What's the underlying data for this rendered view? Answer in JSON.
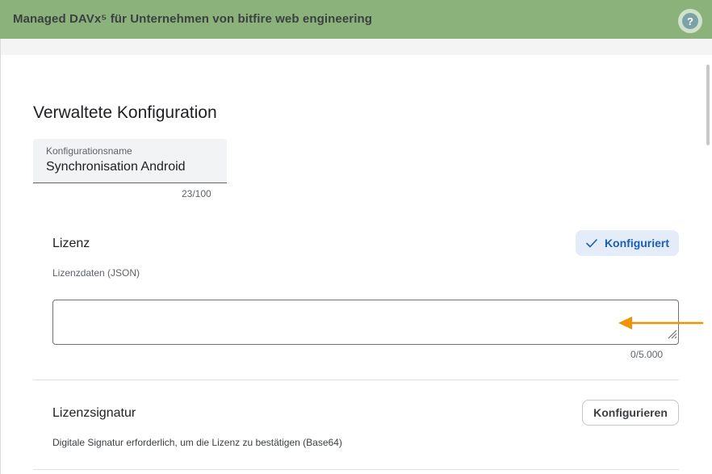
{
  "header": {
    "title": "Managed DAVx⁵ für Unternehmen von bitfire web engineering",
    "help_icon": "help-icon",
    "help_glyph": "?"
  },
  "page": {
    "title": "Verwaltete Konfiguration"
  },
  "config_name": {
    "label": "Konfigurationsname",
    "value": "Synchronisation Android",
    "counter": "23/100"
  },
  "license": {
    "title": "Lizenz",
    "subtitle": "Lizenzdaten (JSON)",
    "status_button": "Konfiguriert",
    "status_icon": "check-icon",
    "input_value": "",
    "counter": "0/5.000"
  },
  "signature": {
    "title": "Lizenzsignatur",
    "description": "Digitale Signatur erforderlich, um die Lizenz zu bestätigen (Base64)",
    "button": "Konfigurieren"
  },
  "colors": {
    "header_bg": "#8ab27a",
    "accent": "#1a5fb4",
    "annotation_arrow": "#f39200"
  }
}
